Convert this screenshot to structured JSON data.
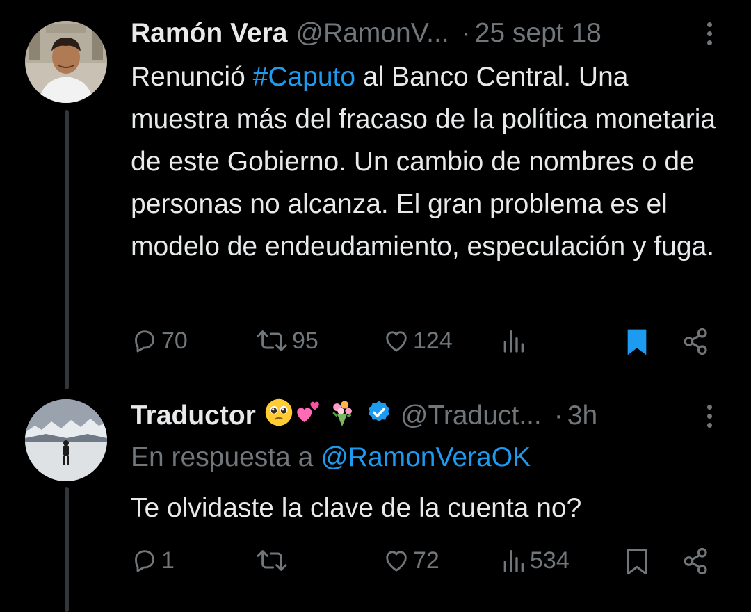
{
  "tweets": [
    {
      "display_name": "Ramón Vera",
      "handle": "@RamonV...",
      "separator": "·",
      "time": "25 sept 18",
      "text_before": "Renunció ",
      "hashtag": "#Caputo",
      "text_after": " al Banco Central. Una muestra más del fracaso de la política monetaria de este Gobierno. Un cambio de nombres o de personas no alcanza. El gran problema es el modelo de endeudamiento, especulación y fuga.",
      "actions": {
        "replies": "70",
        "retweets": "95",
        "likes": "124",
        "views": "",
        "bookmarked": true
      },
      "icons": [
        "reply-icon",
        "retweet-icon",
        "heart-icon",
        "views-icon",
        "bookmark-icon",
        "share-icon",
        "more-icon"
      ]
    },
    {
      "display_name": "Traductor",
      "handle": "@Traduct...",
      "separator": "·",
      "time": "3h",
      "reply_prefix": "En respuesta a",
      "reply_mention": "@RamonVeraOK",
      "text": "Te olvidaste la clave de la cuenta no?",
      "actions": {
        "replies": "1",
        "retweets": "",
        "likes": "72",
        "views": "534",
        "bookmarked": false
      },
      "icons": [
        "pleading-face-emoji",
        "two-hearts-emoji",
        "bouquet-emoji",
        "verified-badge-icon"
      ]
    }
  ],
  "colors": {
    "background": "#000000",
    "text": "#e7e9ea",
    "muted": "#71767b",
    "link": "#1d9bf0",
    "thread_line": "#333639",
    "verified": "#1d9bf0"
  }
}
